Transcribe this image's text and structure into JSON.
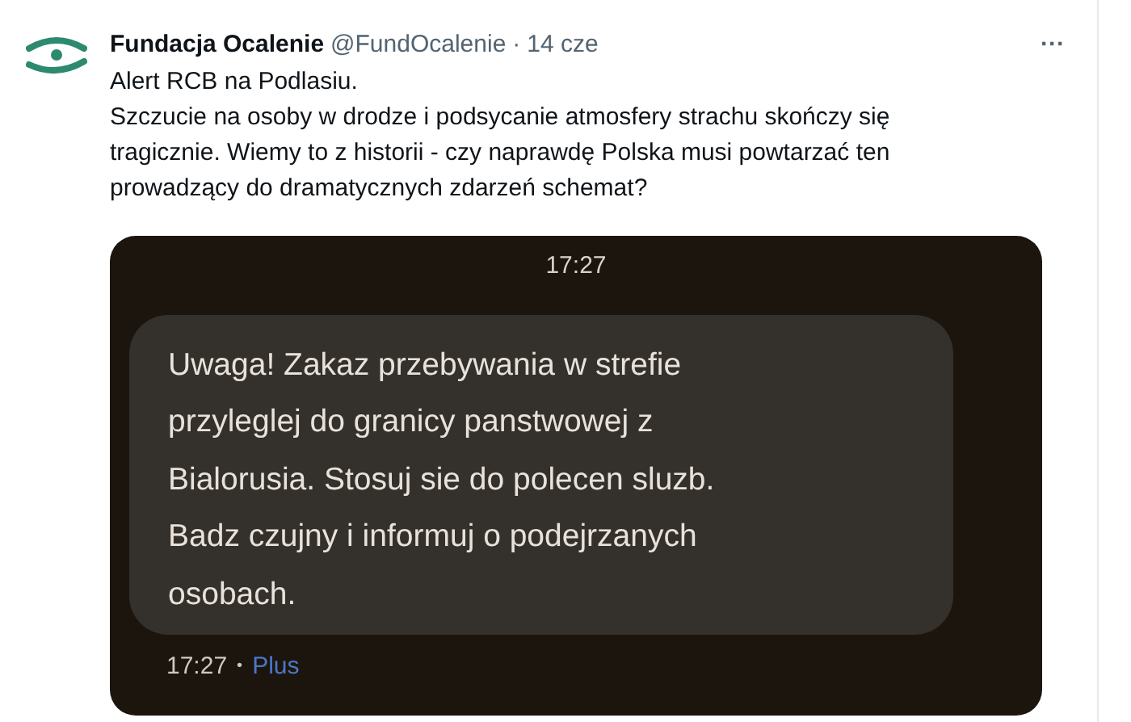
{
  "tweet": {
    "author": "Fundacja Ocalenie",
    "handle": "@FundOcalenie",
    "separator": "·",
    "date": "14 cze",
    "more": "···",
    "text_lines": [
      "Alert RCB na Podlasiu.",
      "Szczucie na osoby w drodze i podsycanie atmosfery strachu skończy się",
      "tragicznie. Wiemy to z historii - czy naprawdę Polska musi powtarzać ten",
      "prowadzący do dramatycznych zdarzeń schemat?"
    ]
  },
  "screenshot": {
    "time": "17:27",
    "message_lines": [
      "Uwaga! Zakaz przebywania w strefie",
      "przyleglej do granicy panstwowej z",
      "Bialorusia. Stosuj sie do polecen sluzb.",
      "Badz czujny i informuj o podejrzanych",
      "osobach."
    ],
    "footer_time": "17:27",
    "footer_separator": "•",
    "footer_sim": "Plus"
  }
}
